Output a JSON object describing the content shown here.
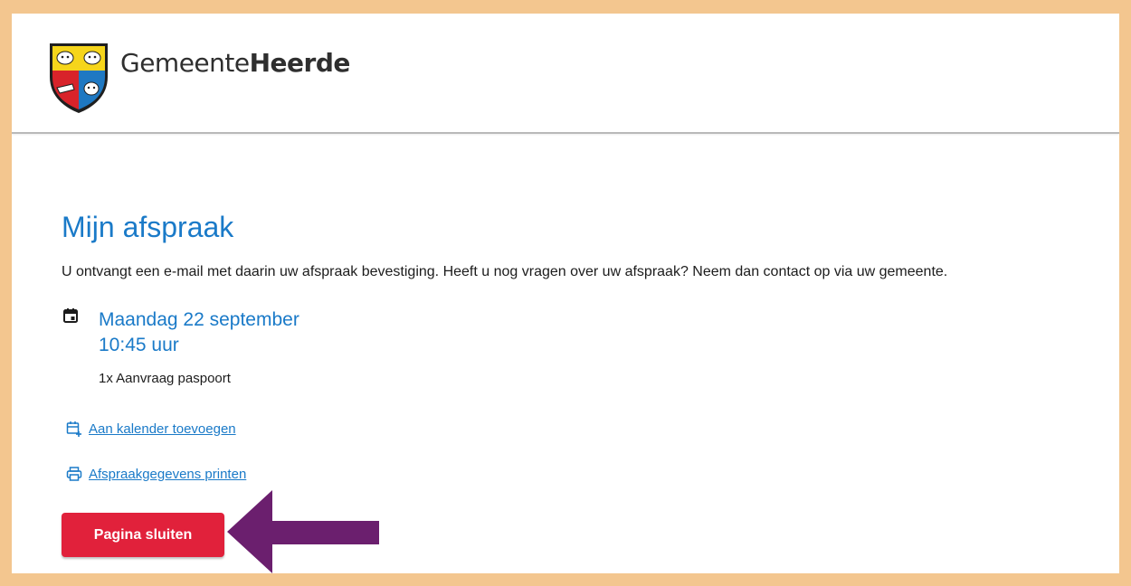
{
  "header": {
    "brand_light": "Gemeente",
    "brand_bold": "Heerde"
  },
  "main": {
    "title": "Mijn afspraak",
    "intro": "U ontvangt een e-mail met daarin uw afspraak bevestiging. Heeft u nog vragen over uw afspraak? Neem dan contact op via uw gemeente.",
    "date": "Maandag 22 september",
    "time": "10:45 uur",
    "product": "1x Aanvraag paspoort",
    "links": {
      "calendar": "Aan kalender toevoegen",
      "print": "Afspraakgegevens printen"
    },
    "close_button": "Pagina sluiten"
  },
  "icons": {
    "calendar": "calendar-icon",
    "calendar_add": "calendar-add-icon",
    "printer": "printer-icon",
    "annotation": "arrow-annotation"
  },
  "colors": {
    "page_border": "#f3c68f",
    "accent_blue": "#1a7ac8",
    "button_red": "#e1213b",
    "arrow_purple": "#6b1f6e"
  }
}
